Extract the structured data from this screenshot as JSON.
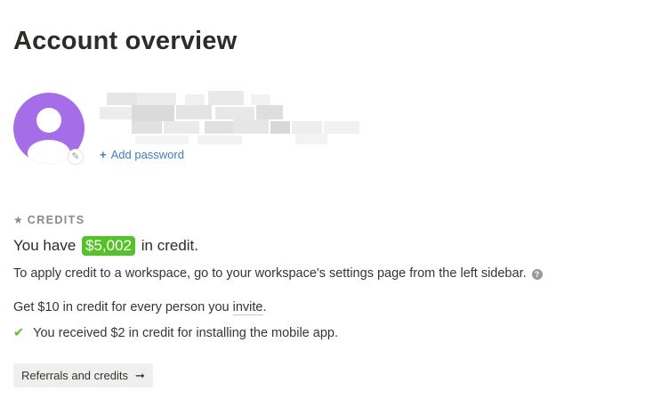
{
  "page": {
    "title": "Account overview"
  },
  "profile": {
    "edit_icon": "pencil-icon",
    "add_password_icon": "plus-icon",
    "add_password_label": "Add password"
  },
  "credits": {
    "section_icon": "star-icon",
    "section_label": "CREDITS",
    "credit_prefix": "You have",
    "credit_amount": "$5,002",
    "credit_suffix": "in credit.",
    "apply_text": "To apply credit to a workspace, go to your workspace's settings page from the left sidebar.",
    "help_icon": "question-circle-icon",
    "invite_prefix": "Get $10 in credit for every person you",
    "invite_link": "invite",
    "invite_suffix": ".",
    "received_icon": "checkmark-icon",
    "received_text": "You received $2 in credit for installing the mobile app.",
    "button_label": "Referrals and credits",
    "button_icon": "arrow-right-icon"
  },
  "colors": {
    "credit_badge": "#56c22a",
    "avatar": "#a56de8",
    "link": "#3f7dbf"
  }
}
